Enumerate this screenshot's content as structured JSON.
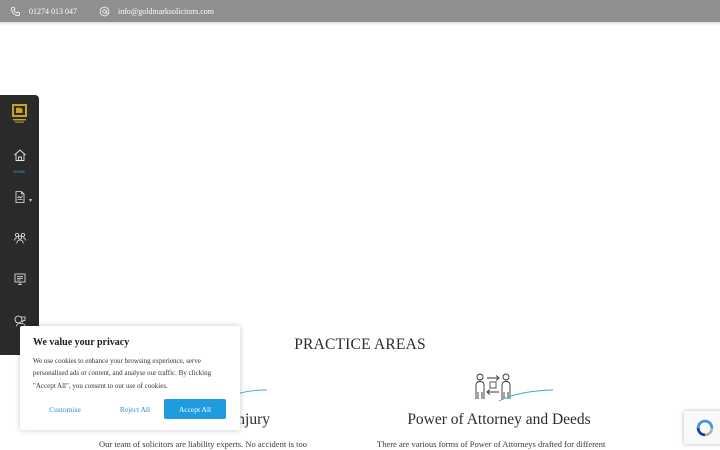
{
  "topbar": {
    "phone": "01274 013 047",
    "email": "info@goldmarksolicitors.com"
  },
  "sidebar": {
    "items": [
      {
        "icon": "home-icon",
        "label": "HOME"
      },
      {
        "icon": "document-icon",
        "label": ""
      },
      {
        "icon": "team-icon",
        "label": ""
      },
      {
        "icon": "news-icon",
        "label": ""
      },
      {
        "icon": "contact-icon",
        "label": ""
      }
    ],
    "active_color": "#3aa5d8"
  },
  "main": {
    "section_title": "PRACTICE AREAS",
    "areas": [
      {
        "icon": "injury-icon",
        "title": "Injury",
        "text": "Our team of solicitors are liability experts. No accident is too"
      },
      {
        "icon": "people-exchange-icon",
        "title": "Power of Attorney and Deeds",
        "text": "There are various forms of Power of Attorneys drafted for different"
      }
    ]
  },
  "cookie": {
    "title": "We value your privacy",
    "body": "We use cookies to enhance your browsing experience, serve personalised ads or content, and analyse our traffic. By clicking \"Accept All\", you consent to our use of cookies.",
    "customise": "Customise",
    "reject": "Reject All",
    "accept": "Accept All"
  },
  "colors": {
    "topbar": "#8f8f8f",
    "sidebar": "#2a2a2a",
    "accent": "#1f9be0",
    "gold": "#c9a227"
  }
}
